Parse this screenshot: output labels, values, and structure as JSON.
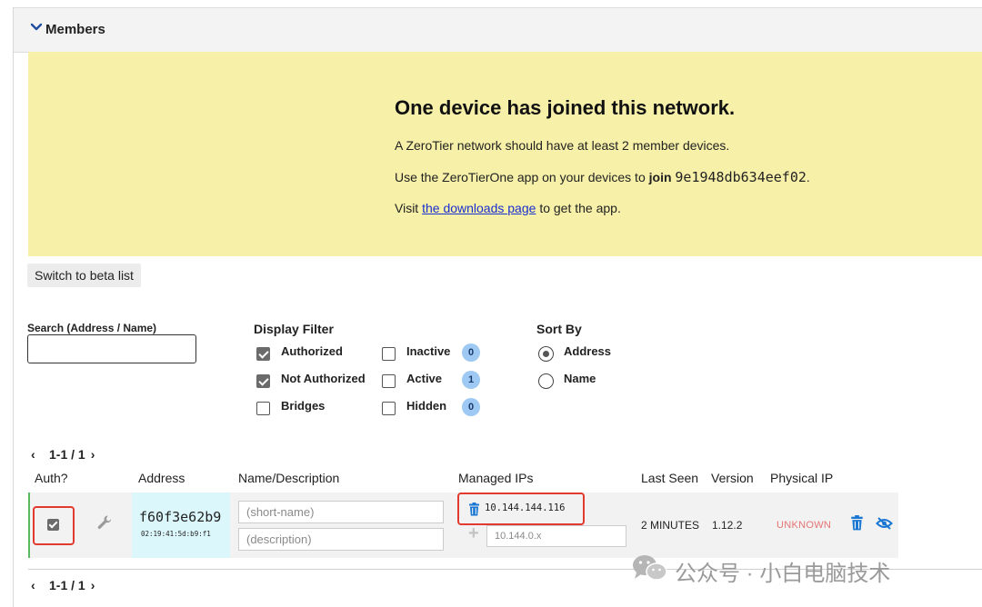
{
  "panel": {
    "title": "Members"
  },
  "banner": {
    "heading": "One device has joined this network.",
    "line1": "A ZeroTier network should have at least 2 member devices.",
    "line2_prefix": "Use the ZeroTierOne app on your devices to",
    "line2_join": "join",
    "network_id": "9e1948db634eef02",
    "line2_suffix": ".",
    "line3_prefix": "Visit",
    "line3_link": "the downloads page",
    "line3_suffix": "to get the app."
  },
  "beta_button": "Switch to beta list",
  "search": {
    "label": "Search (Address / Name)",
    "value": ""
  },
  "display_filter": {
    "title": "Display Filter",
    "authorized": {
      "label": "Authorized",
      "checked": true
    },
    "not_authorized": {
      "label": "Not Authorized",
      "checked": true
    },
    "bridges": {
      "label": "Bridges",
      "checked": false
    },
    "inactive": {
      "label": "Inactive",
      "checked": false,
      "count": "0"
    },
    "active": {
      "label": "Active",
      "checked": false,
      "count": "1"
    },
    "hidden": {
      "label": "Hidden",
      "checked": false,
      "count": "0"
    }
  },
  "sort_by": {
    "title": "Sort By",
    "address": {
      "label": "Address",
      "selected": true
    },
    "name": {
      "label": "Name",
      "selected": false
    }
  },
  "pager": {
    "text": "1-1 / 1",
    "prev": "‹",
    "next": "›"
  },
  "table": {
    "headers": {
      "auth": "Auth?",
      "address": "Address",
      "name": "Name/Description",
      "managed_ips": "Managed IPs",
      "last_seen": "Last Seen",
      "version": "Version",
      "physical_ip": "Physical IP"
    },
    "rows": [
      {
        "authorized": true,
        "address": "f60f3e62b9",
        "mac": "02:19:41:5d:b9:f1",
        "short_name_placeholder": "(short-name)",
        "short_name_value": "",
        "description_placeholder": "(description)",
        "description_value": "",
        "managed_ip": "10.144.144.116",
        "new_ip_placeholder": "10.144.0.x",
        "last_seen": "2 MINUTES",
        "version": "1.12.2",
        "physical_ip": "UNKNOWN"
      }
    ]
  },
  "watermark": {
    "text": "公众号 · 小白电脑技术"
  },
  "colors": {
    "banner_bg": "#f7f0a8",
    "address_bg": "#dcf7fb",
    "highlight_red": "#e23a2e",
    "accent_blue": "#1976d2",
    "unknown_red": "#e57373",
    "link_blue": "#1a2fd0"
  },
  "icons": {
    "collapse": "chevron-down-icon",
    "settings": "wrench-icon",
    "delete_ip": "trash-icon",
    "add_ip": "plus-icon",
    "delete_member": "trash-icon",
    "hide_member": "eye-slash-icon",
    "watermark": "wechat-icon"
  }
}
